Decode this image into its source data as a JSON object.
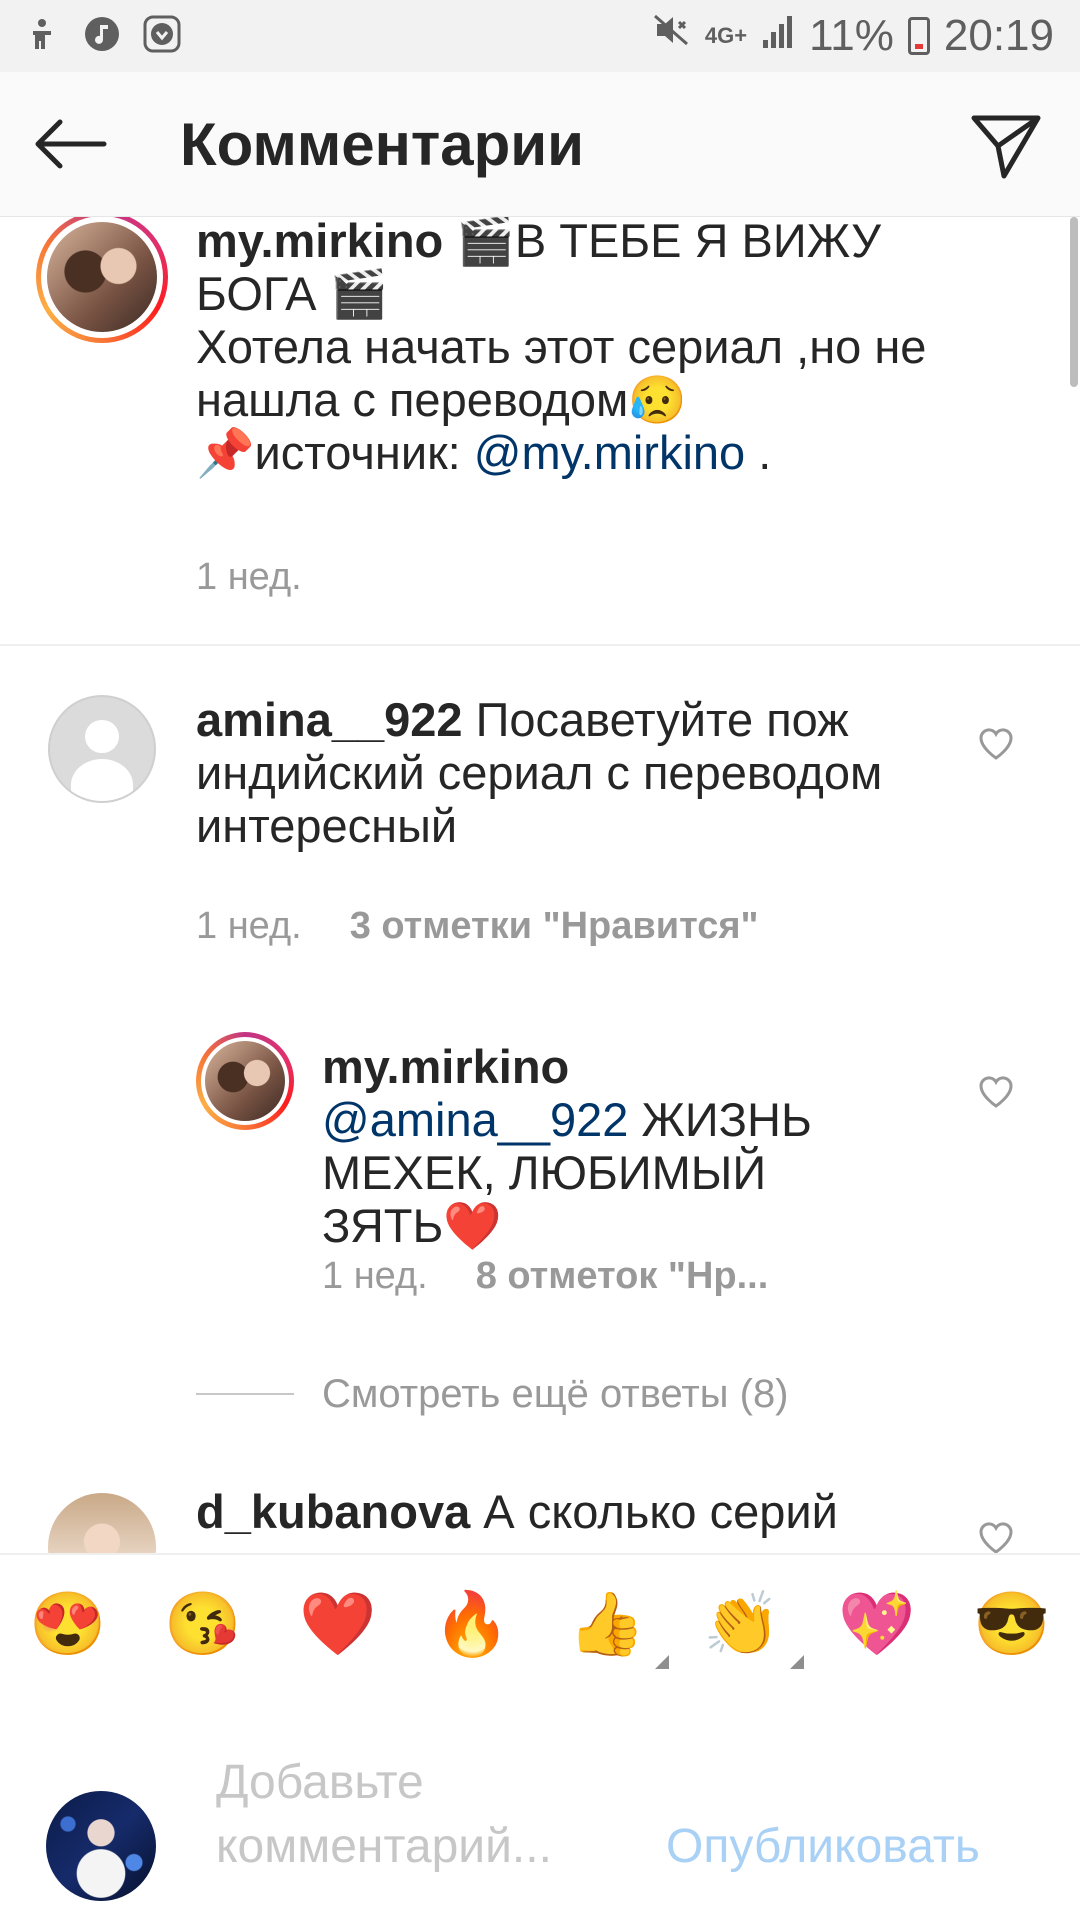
{
  "status_bar": {
    "left_icons": [
      "accessibility-icon",
      "music-icon",
      "download-icon"
    ],
    "network": "4G+",
    "battery": "11%",
    "time": "20:19"
  },
  "app_bar": {
    "title": "Комментарии"
  },
  "caption": {
    "username": "my.mirkino",
    "line1": " 🎬В ТЕБЕ Я ВИЖУ БОГА 🎬",
    "line2": "Хотела начать этот сериал ,но не нашла с переводом😥",
    "line3_prefix": "📌источник: ",
    "mention": "@my.mirkino",
    "line3_suffix": " .",
    "time": "1 нед."
  },
  "comments": [
    {
      "username": "amina__922",
      "text": " Посаветуйте пож индийский сериал с переводом интересный",
      "time": "1 нед.",
      "likes": "3 отметки \"Нравится\""
    },
    {
      "username": "my.mirkino",
      "mention": " @amina__922",
      "text": " ЖИЗНЬ МЕХЕК, ЛЮБИМЫЙ ЗЯТЬ❤️",
      "time": "1 нед.",
      "likes": "8 отметок \"Нр..."
    },
    {
      "username": "d_kubanova",
      "text": " А сколько серий"
    }
  ],
  "view_more_replies": "Смотреть ещё ответы (8)",
  "emoji_bar": [
    "😍",
    "😘",
    "❤️",
    "🔥",
    "👍",
    "👏",
    "💖",
    "😎"
  ],
  "composer": {
    "placeholder": "Добавьте комментарий...",
    "publish_label": "Опубликовать"
  },
  "colors": {
    "mention": "#003569",
    "publish": "#a9d0f5",
    "meta": "#999999"
  }
}
